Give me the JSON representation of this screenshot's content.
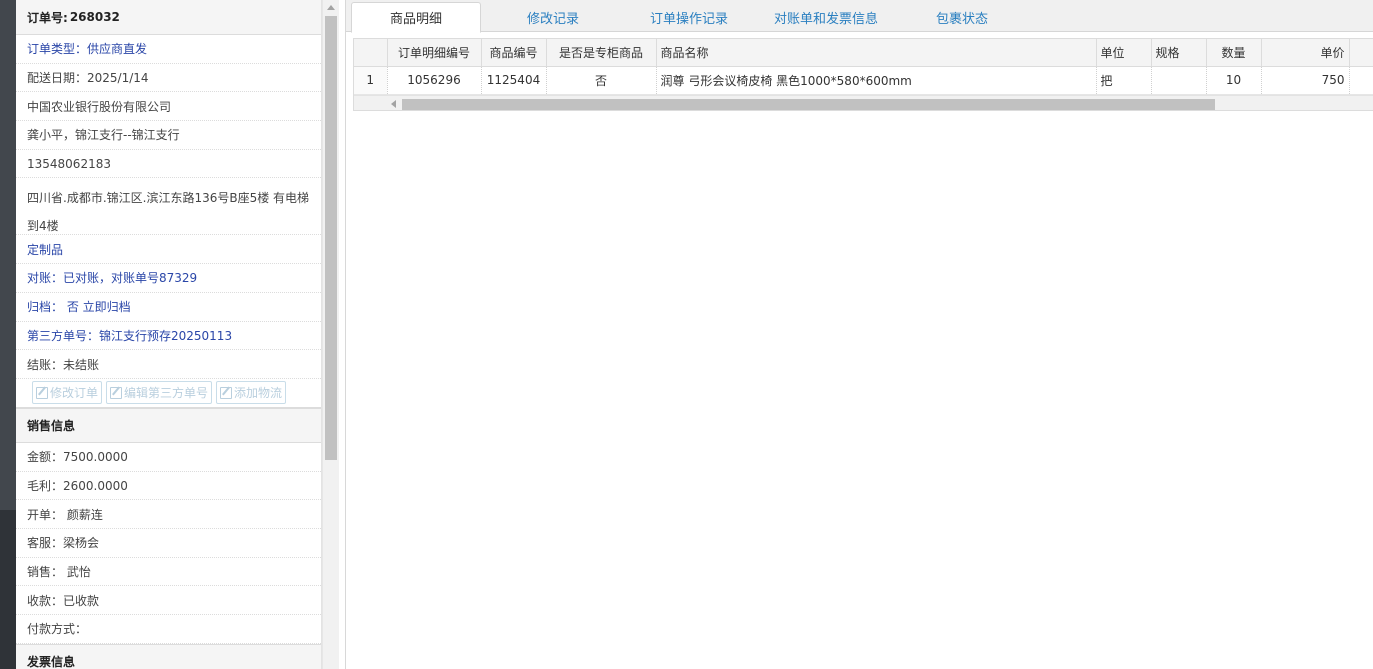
{
  "order": {
    "label": "订单号:",
    "number": "268032"
  },
  "info_rows": [
    {
      "text": "订单类型：供应商直发",
      "color": "blue"
    },
    {
      "text": "配送日期：2025/1/14",
      "color": "normal"
    },
    {
      "text": "中国农业银行股份有限公司",
      "color": "normal"
    },
    {
      "text": "龚小平，锦江支行--锦江支行",
      "color": "normal"
    },
    {
      "text": "13548062183",
      "color": "normal"
    },
    {
      "text": "四川省.成都市.锦江区.滨江东路136号B座5楼 有电梯到4楼",
      "color": "normal"
    },
    {
      "text": "定制品",
      "color": "blue"
    },
    {
      "text": "对账：已对账，对账单号87329",
      "color": "blue"
    },
    {
      "text": "归档： 否 立即归档",
      "color": "blue"
    },
    {
      "text": "第三方单号：锦江支行预存20250113",
      "color": "blue"
    },
    {
      "text": "结账：未结账",
      "color": "normal"
    }
  ],
  "actions": {
    "edit_order": "修改订单",
    "edit_third_party": "编辑第三方单号",
    "add_logistics": "添加物流"
  },
  "sales": {
    "title": "销售信息",
    "rows": [
      "金额：7500.0000",
      "毛利：2600.0000",
      "开单： 颜薪连",
      "客服：梁杨会",
      "销售： 武怡",
      "收款：已收款",
      "付款方式："
    ]
  },
  "invoice": {
    "title": "发票信息"
  },
  "tabs": [
    {
      "label": "商品明细",
      "active": true
    },
    {
      "label": "修改记录",
      "active": false
    },
    {
      "label": "订单操作记录",
      "active": false
    },
    {
      "label": "对账单和发票信息",
      "active": false
    },
    {
      "label": "包裹状态",
      "active": false
    }
  ],
  "grid": {
    "headers": [
      "",
      "订单明细编号",
      "商品编号",
      "是否是专柜商品",
      "商品名称",
      "单位",
      "规格",
      "数量",
      "单价"
    ],
    "rows": [
      [
        "1",
        "1056296",
        "1125404",
        "否",
        "润尊 弓形会议椅皮椅 黑色1000*580*600mm",
        "把",
        "",
        "10",
        "750"
      ]
    ]
  },
  "colors": {
    "link_blue": "#2a46a8",
    "tab_blue": "#2a7fc0",
    "header_bg": "#f5f5f5"
  },
  "icons": {
    "edit": "edit-icon"
  }
}
